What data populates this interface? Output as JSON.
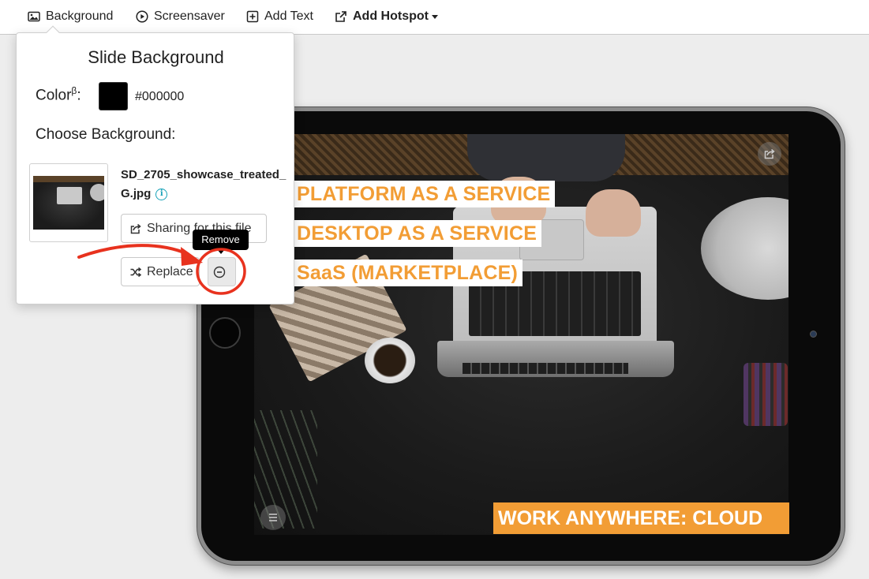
{
  "toolbar": {
    "items": [
      {
        "label": "Background",
        "icon": "image-icon"
      },
      {
        "label": "Screensaver",
        "icon": "play-circle-icon"
      },
      {
        "label": "Add Text",
        "icon": "plus-square-icon"
      },
      {
        "label": "Add Hotspot",
        "icon": "external-link-icon"
      }
    ]
  },
  "panel": {
    "title": "Slide Background",
    "color_label": "Color",
    "color_superscript": "β",
    "color_suffix": ":",
    "color_value": "#000000",
    "choose_label": "Choose Background:",
    "file_name": "SD_2705_showcase_treated_G.jpg",
    "sharing_label": "Sharing for this file",
    "replace_label": "Replace"
  },
  "tooltip": {
    "text": "Remove"
  },
  "slide": {
    "labels": [
      "PLATFORM AS A SERVICE",
      "DESKTOP AS A SERVICE",
      "SaaS (MARKETPLACE)"
    ],
    "footer_label": "WORK ANYWHERE: CLOUD"
  },
  "colors": {
    "accent_orange": "#f29d35",
    "annotation_red": "#e8321e",
    "info_teal": "#17a2b8"
  }
}
